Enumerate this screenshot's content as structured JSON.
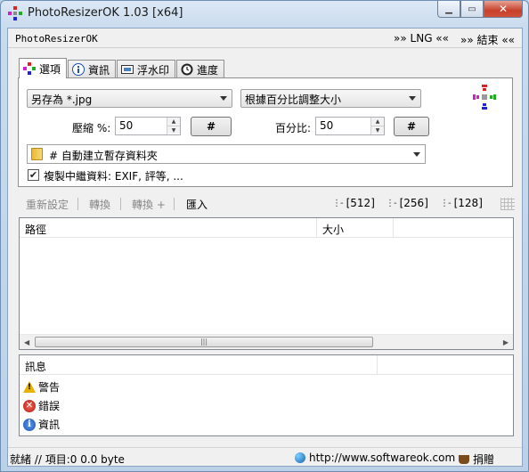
{
  "window": {
    "title": "PhotoResizerOK 1.03 [x64]"
  },
  "menubar": {
    "brand": "PhotoResizerOK",
    "lng": "»» LNG ««",
    "exit": "»» 結束 ««"
  },
  "tabs": [
    {
      "label": "選項",
      "icon": "gear-icon"
    },
    {
      "label": "資訊",
      "icon": "info-icon"
    },
    {
      "label": "浮水印",
      "icon": "watermark-icon"
    },
    {
      "label": "進度",
      "icon": "clock-icon"
    }
  ],
  "options": {
    "save_as": "另存為 *.jpg",
    "resize_mode": "根據百分比調整大小",
    "compression_label": "壓縮 %:",
    "compression_value": "50",
    "percent_label": "百分比:",
    "percent_value": "50",
    "hash_label": "#",
    "folder": "# 自動建立暫存資料夾",
    "copy_metadata": "複製中繼資料: EXIF, 評等, ...",
    "copy_metadata_checked": true
  },
  "toolbar": {
    "reset": "重新設定",
    "convert": "轉換",
    "convert_plus": "轉換 +",
    "import": "匯入",
    "size_512": "[512]",
    "size_256": "[256]",
    "size_128": "[128]"
  },
  "list": {
    "columns": [
      "路徑",
      "大小"
    ]
  },
  "messages": {
    "header": "訊息",
    "rows": [
      {
        "label": "警告",
        "icon": "warning-icon"
      },
      {
        "label": "錯誤",
        "icon": "error-icon"
      },
      {
        "label": "資訊",
        "icon": "info-icon"
      }
    ]
  },
  "status": {
    "text": "就緒 // 項目:0 0.0 byte",
    "url": "http://www.softwareok.com",
    "donate": "捐贈"
  }
}
